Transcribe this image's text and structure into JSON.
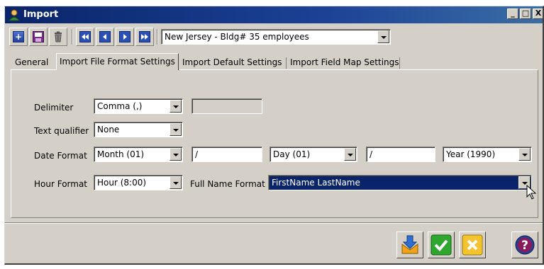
{
  "window": {
    "title": "Import",
    "caption_buttons": [
      "_",
      "□",
      "X"
    ]
  },
  "toolbar": {
    "dataset_value": "New Jersey - Bldg# 35 employees",
    "icons": [
      "add-icon",
      "save-icon",
      "delete-icon",
      "first-record-icon",
      "previous-record-icon",
      "next-record-icon",
      "last-record-icon"
    ]
  },
  "tabs": [
    {
      "label": "General"
    },
    {
      "label": "Import File Format Settings",
      "active": true
    },
    {
      "label": "Import Default Settings"
    },
    {
      "label": "Import Field Map Settings"
    }
  ],
  "form": {
    "delimiter": {
      "label": "Delimiter",
      "value": "Comma (,)",
      "other_value": ""
    },
    "text_qualifier": {
      "label": "Text qualifier",
      "value": "None"
    },
    "date_format": {
      "label": "Date Format",
      "first": "Month (01)",
      "sep1": "/",
      "second": "Day (01)",
      "sep2": "/",
      "third": "Year (1990)"
    },
    "hour_format": {
      "label": "Hour Format",
      "value": "Hour (8:00)"
    },
    "full_name_format": {
      "label": "Full Name Format",
      "value": "FirstName LastName"
    }
  },
  "actions": [
    "import-icon",
    "ok-check-icon",
    "cancel-icon",
    "help-icon"
  ],
  "colors": {
    "titlebar": "#0a246a",
    "window_bg": "#d4d0c8",
    "selection": "#0a246a",
    "ok_green": "#2fa62f",
    "cancel_yellow": "#f4c430",
    "help_blue": "#2a3f8f"
  }
}
